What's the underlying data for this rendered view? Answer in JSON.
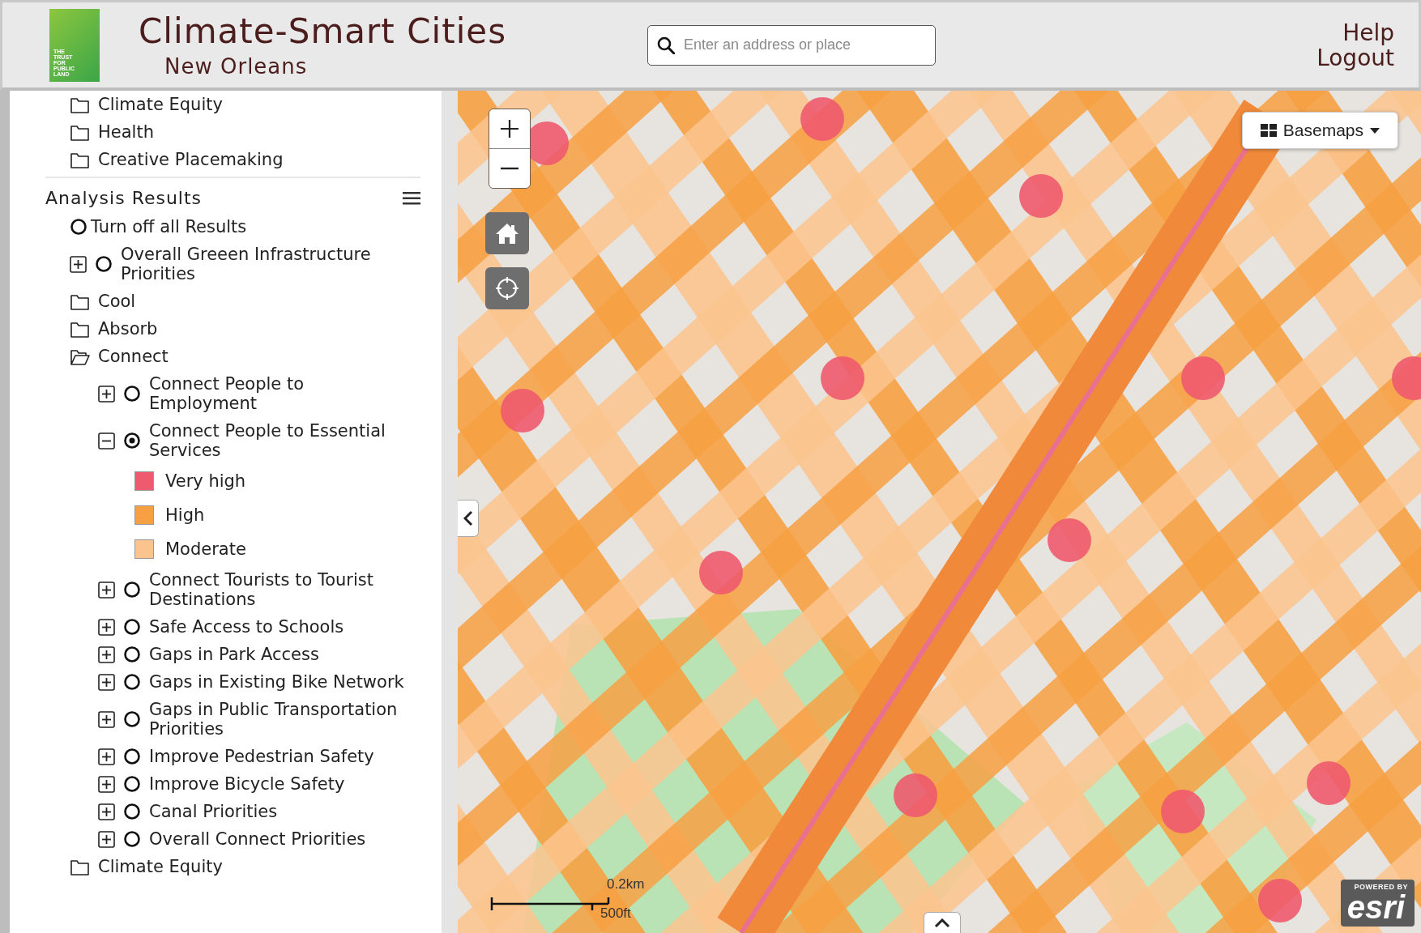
{
  "header": {
    "logo_lines": [
      "THE",
      "TRUST",
      "FOR",
      "PUBLIC",
      "LAND"
    ],
    "title": "Climate-Smart Cities",
    "subtitle": "New Orleans",
    "search": {
      "placeholder": "Enter an address or place"
    },
    "links": [
      "Help",
      "Logout"
    ]
  },
  "sidebar": {
    "folders": [
      {
        "kind": "folder",
        "label": "Climate Equity",
        "expanded": false
      },
      {
        "kind": "folder",
        "label": "Health",
        "expanded": false
      },
      {
        "kind": "folder",
        "label": "Creative Placemaking",
        "expanded": false
      }
    ],
    "analysis": {
      "title": "Analysis Results",
      "items": [
        {
          "kind": "radio",
          "label": "Turn off all Results",
          "selected": false
        },
        {
          "kind": "layer",
          "label": "Overall Greeen Infrastructure Priorities",
          "expanded": false,
          "selected": false
        },
        {
          "kind": "folder",
          "label": "Cool",
          "expanded": false
        },
        {
          "kind": "folder",
          "label": "Absorb",
          "expanded": false
        },
        {
          "kind": "folder",
          "label": "Connect",
          "expanded": true,
          "children": [
            {
              "kind": "layer",
              "label": "Connect People to Employment",
              "expanded": false,
              "selected": false
            },
            {
              "kind": "layer",
              "label": "Connect People to Essential Services",
              "expanded": true,
              "selected": true,
              "legend": [
                {
                  "label": "Very high",
                  "color": "#ee5a6e"
                },
                {
                  "label": "High",
                  "color": "#f7a043"
                },
                {
                  "label": "Moderate",
                  "color": "#fbc48e"
                }
              ]
            },
            {
              "kind": "layer",
              "label": "Connect Tourists to Tourist Destinations",
              "expanded": false,
              "selected": false
            },
            {
              "kind": "layer",
              "label": "Safe Access to Schools",
              "expanded": false,
              "selected": false
            },
            {
              "kind": "layer",
              "label": "Gaps in Park Access",
              "expanded": false,
              "selected": false
            },
            {
              "kind": "layer",
              "label": "Gaps in Existing Bike Network",
              "expanded": false,
              "selected": false
            },
            {
              "kind": "layer",
              "label": "Gaps in Public Transportation Priorities",
              "expanded": false,
              "selected": false
            },
            {
              "kind": "layer",
              "label": "Improve Pedestrian Safety",
              "expanded": false,
              "selected": false
            },
            {
              "kind": "layer",
              "label": "Improve Bicycle Safety",
              "expanded": false,
              "selected": false
            },
            {
              "kind": "layer",
              "label": "Canal Priorities",
              "expanded": false,
              "selected": false
            },
            {
              "kind": "layer",
              "label": "Overall Connect Priorities",
              "expanded": false,
              "selected": false
            }
          ]
        },
        {
          "kind": "folder",
          "label": "Climate Equity",
          "expanded": false
        }
      ]
    }
  },
  "map": {
    "basemaps_label": "Basemaps",
    "scale_labels": [
      "0.2km",
      "500ft"
    ],
    "attribution": {
      "small": "POWERED BY",
      "logo": "esri"
    }
  }
}
